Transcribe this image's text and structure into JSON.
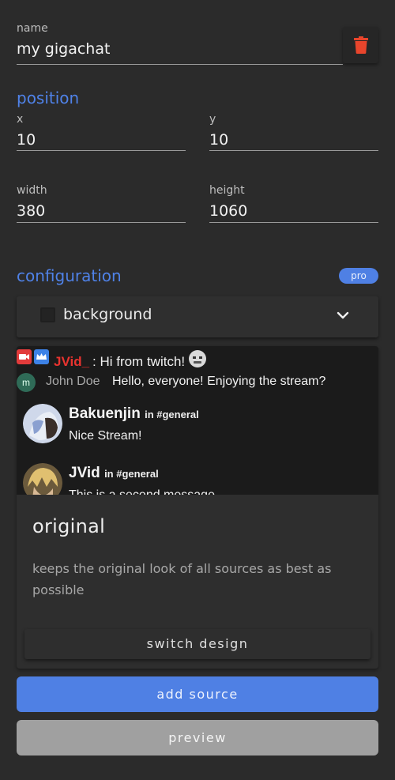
{
  "name_field": {
    "label": "name",
    "value": "my gigachat"
  },
  "delete_button": {
    "icon": "trash-icon",
    "color": "#e8452c"
  },
  "position": {
    "title": "position",
    "x": {
      "label": "x",
      "value": "10"
    },
    "y": {
      "label": "y",
      "value": "10"
    },
    "width": {
      "label": "width",
      "value": "380"
    },
    "height": {
      "label": "height",
      "value": "1060"
    }
  },
  "configuration": {
    "title": "configuration",
    "badge": "pro",
    "background": {
      "label": "background",
      "checked": false,
      "icon": "chevron-down-icon"
    }
  },
  "chat_preview": {
    "twitch": {
      "user": "JVid_",
      "message": ": Hi from twitch!",
      "icons": [
        "camera-icon",
        "crown-icon",
        "emote-icon"
      ]
    },
    "youtube": {
      "avatar_letter": "m",
      "user": "John Doe",
      "message": "Hello, everyone! Enjoying the stream?"
    },
    "discord": [
      {
        "user": "Bakuenjin",
        "channel": "in #general",
        "message": "Nice Stream!"
      },
      {
        "user": "JVid",
        "channel": "in #general",
        "message": "This is a second message"
      }
    ]
  },
  "design": {
    "name": "original",
    "description": "keeps the original look of all sources as best as possible",
    "switch_label": "switch design"
  },
  "buttons": {
    "add_source": "add source",
    "preview": "preview"
  },
  "colors": {
    "accent": "#4f80e4",
    "background": "#2b2b2b",
    "danger": "#e8452c"
  }
}
